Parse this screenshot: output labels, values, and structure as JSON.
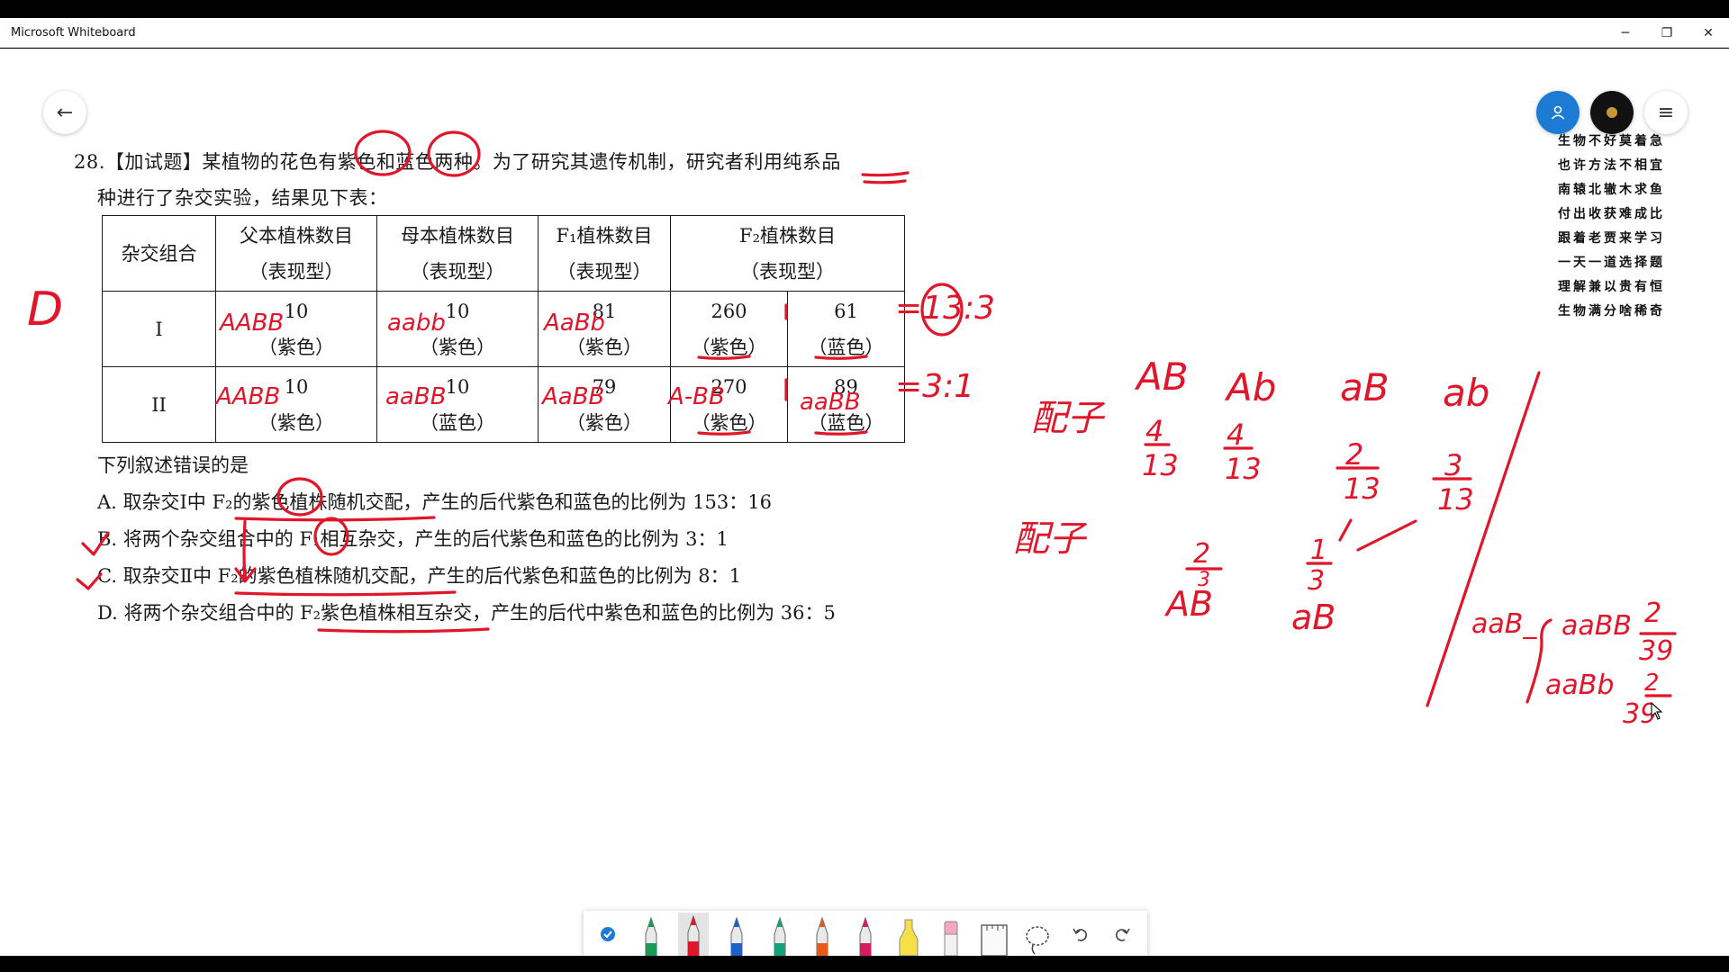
{
  "window": {
    "title": "Microsoft Whiteboard",
    "minimize": "─",
    "restore": "❐",
    "close": "✕"
  },
  "nav": {
    "back_glyph": "←",
    "menu_glyph": "≡"
  },
  "question": {
    "line1": "28.【加试题】某植物的花色有紫色和蓝色两种。为了研究其遗传机制，研究者利用纯系品",
    "line2": "种进行了杂交实验，结果见下表："
  },
  "table": {
    "header": [
      {
        "main": "杂交组合",
        "sub": ""
      },
      {
        "main": "父本植株数目",
        "sub": "（表现型）"
      },
      {
        "main": "母本植株数目",
        "sub": "（表现型）"
      },
      {
        "main": "F₁植株数目",
        "sub": "（表现型）"
      },
      {
        "main": "F₂植株数目",
        "sub": "（表现型）"
      }
    ],
    "rows": [
      {
        "group": "I",
        "father": "10",
        "father_p": "（紫色）",
        "mother": "10",
        "mother_p": "（紫色）",
        "f1": "81",
        "f1_p": "（紫色）",
        "f2a": "260",
        "f2a_p": "（紫色）",
        "f2b": "61",
        "f2b_p": "（蓝色）"
      },
      {
        "group": "II",
        "father": "10",
        "father_p": "（紫色）",
        "mother": "10",
        "mother_p": "（蓝色）",
        "f1": "79",
        "f1_p": "（紫色）",
        "f2a": "270",
        "f2a_p": "（紫色）",
        "f2b": "89",
        "f2b_p": "（蓝色）"
      }
    ]
  },
  "prompt": "下列叙述错误的是",
  "options": [
    "A. 取杂交Ⅰ中 F₂的紫色植株随机交配，产生的后代紫色和蓝色的比例为 153：16",
    "B. 将两个杂交组合中的 F₁相互杂交，产生的后代紫色和蓝色的比例为 3：1",
    "C. 取杂交Ⅱ中 F₂的紫色植株随机交配，产生的后代紫色和蓝色的比例为 8：1",
    "D. 将两个杂交组合中的 F₂紫色植株相互杂交，产生的后代中紫色和蓝色的比例为 36：5"
  ],
  "poem": [
    "生物不好莫着急",
    "也许方法不相宜",
    "南辕北辙木求鱼",
    "付出收获难成比",
    "跟着老贾来学习",
    "一天一道选择题",
    "理解兼以贵有恒",
    "生物满分啥稀奇"
  ],
  "ink": {
    "answer": "D",
    "geno_I_father": "AABB",
    "geno_I_mother": "aabb",
    "geno_I_f1": "AaBb",
    "geno_II_father": "AABB",
    "geno_II_mother": "aaBB",
    "geno_II_f1": "AaBB",
    "geno_II_f2a": "A-BB",
    "geno_II_f2b": "aaBB",
    "ratio1": "=13:3",
    "ratio2": "=3:1",
    "gamete_label": "配子",
    "gametes": [
      "AB",
      "Ab",
      "aB",
      "ab"
    ],
    "gamete_nums": [
      "4",
      "4",
      "2",
      "3"
    ],
    "gamete_den": "13",
    "gamete2_label": "配子",
    "g2_num1": "2",
    "g2_den1": "3",
    "g2_geno1": "AB",
    "g2_num2": "1",
    "g2_den2": "3",
    "g2_geno2": "aB",
    "aabb_label": "aaB_",
    "aabb_1": "aaBB",
    "aabb_2": "aaBb",
    "frac_num": "2",
    "frac_den": "39"
  },
  "colors": {
    "ink": "#e0162b",
    "accent": "#1e7bd3"
  }
}
